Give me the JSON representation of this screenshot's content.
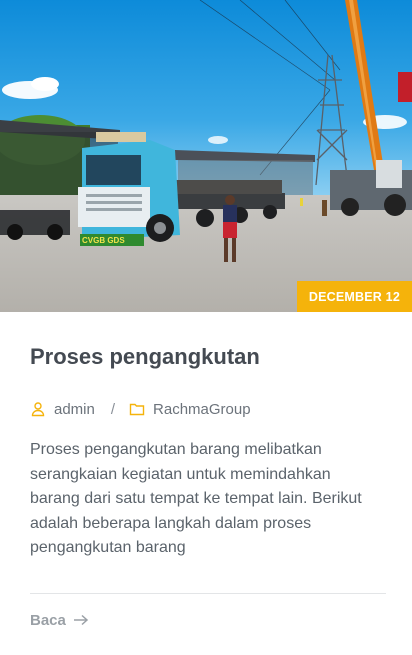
{
  "post": {
    "date_badge": "DECEMBER 12",
    "title": "Proses pengangkutan",
    "author": "admin",
    "author_icon": "user-icon",
    "category": "RachmaGroup",
    "category_icon": "folder-icon",
    "separator": "/",
    "excerpt": "Proses pengangkutan barang melibatkan serangkaian kegiatan untuk memindahkan barang dari satu tempat ke tempat lain. Berikut adalah beberapa langkah dalam proses pengangkutan barang",
    "read_more": "Baca",
    "read_more_icon": "arrow-right-icon",
    "truck_plate": "CVGB GDS"
  },
  "colors": {
    "accent": "#f5b30b",
    "title": "#444a52",
    "text": "#5b636b",
    "muted": "#9aa0a6"
  }
}
